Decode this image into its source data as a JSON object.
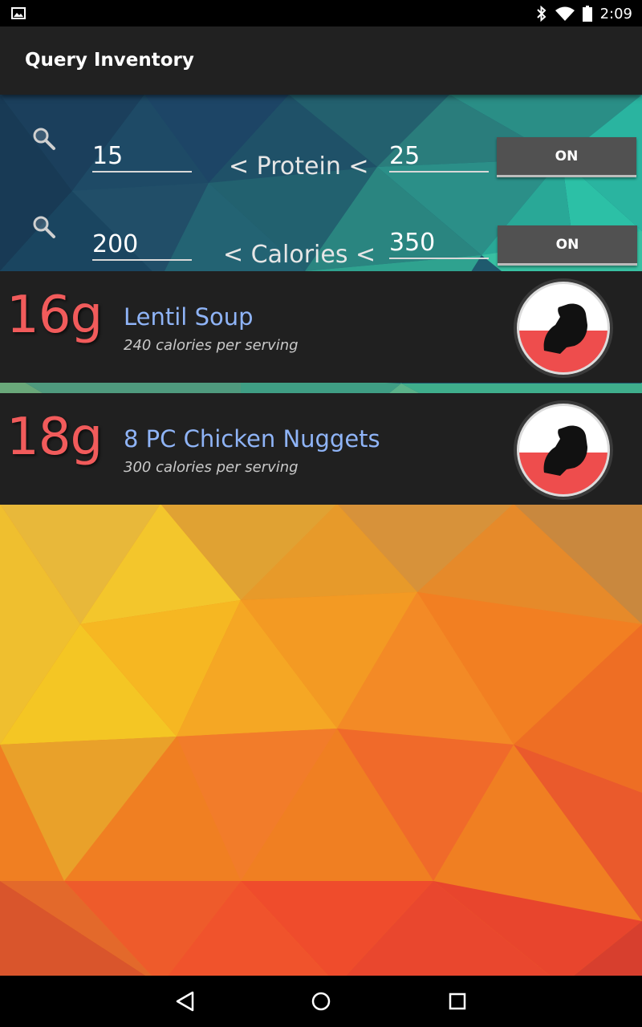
{
  "status_bar": {
    "time": "2:09",
    "icons": [
      "gallery-icon",
      "bluetooth-icon",
      "wifi-icon",
      "battery-icon"
    ]
  },
  "app_bar": {
    "title": "Query Inventory"
  },
  "query": {
    "protein": {
      "min": "15",
      "label": "< Protein <",
      "max": "25",
      "toggle": "ON"
    },
    "calories": {
      "min": "200",
      "label": "< Calories <",
      "max": "350",
      "toggle": "ON"
    }
  },
  "results": [
    {
      "protein": "16g",
      "name": "Lentil Soup",
      "calories": "240 calories per serving",
      "icon": "muscle-badge-icon"
    },
    {
      "protein": "18g",
      "name": "8 PC Chicken Nuggets",
      "calories": "300 calories per serving",
      "icon": "muscle-badge-icon"
    }
  ],
  "nav_bar": {
    "icons": [
      "back-icon",
      "home-icon",
      "recents-icon"
    ]
  },
  "colors": {
    "protein_text": "#f15b5b",
    "name_text": "#8fb4f7",
    "card_bg": "#202020",
    "app_bar_bg": "#212121",
    "toggle_bg": "#515151"
  }
}
